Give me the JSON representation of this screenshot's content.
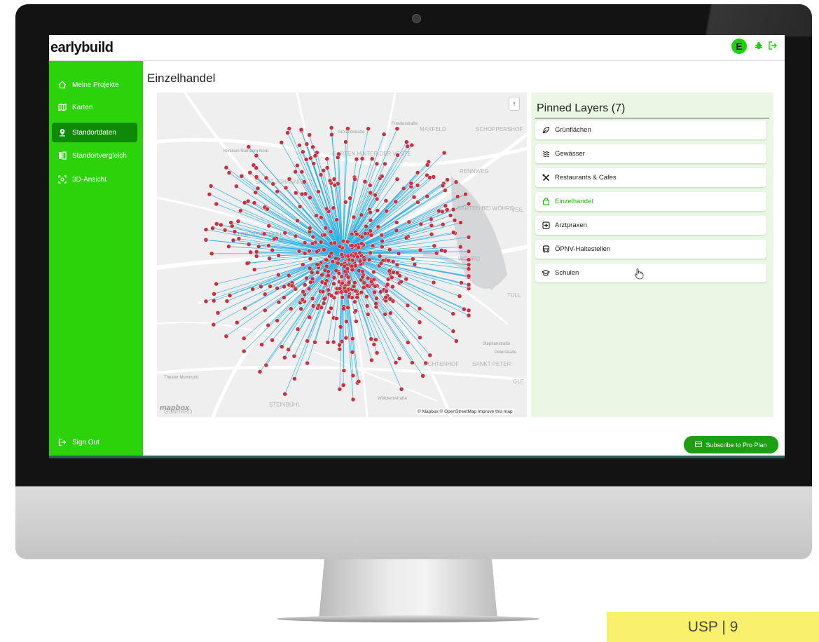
{
  "app": {
    "logo": "earlybuild",
    "user_initial": "E"
  },
  "sidebar": {
    "items": [
      {
        "label": "Meine Projekte",
        "icon": "home-icon"
      },
      {
        "label": "Karten",
        "icon": "map-icon"
      },
      {
        "label": "Standortdaten",
        "icon": "location-pin-icon",
        "active": true
      },
      {
        "label": "Standortvergleich",
        "icon": "compare-icon"
      },
      {
        "label": "3D-Ansicht",
        "icon": "3d-view-icon"
      }
    ],
    "sign_out": "Sign Out",
    "collapse": "‹"
  },
  "main": {
    "title": "Einzelhandel"
  },
  "map": {
    "attribution": "© Mapbox © OpenStreetMap Improve this map",
    "brand": "mapbox",
    "compass": "↑",
    "labels": [
      "Friedenstraße",
      "Grolandstraße",
      "MAXFELD",
      "SCHOPPERSHOF",
      "Klinikum Nürnberg Nord",
      "GARTEN HINTER DER VESTE",
      "RENNWEG",
      "SANKT JOHANNIS",
      "GARTEN BEI WÖHRD",
      "VEIL",
      "KLEINWEIDENMÜHLE",
      "WÖHRD",
      "TULL",
      "Stephanstraße",
      "Peterstraße",
      "SANKT PETER",
      "LICHTENHOF",
      "GLE",
      "Theater Mummpitz",
      "STEINBÜHL",
      "GUNHARD",
      "Wölckernstraße"
    ],
    "line_color": "#29aee6",
    "point_color": "#c8303f"
  },
  "panel": {
    "title": "Pinned Layers (7)",
    "layers": [
      {
        "label": "Grünflächen",
        "icon": "leaf-icon"
      },
      {
        "label": "Gewässer",
        "icon": "water-icon"
      },
      {
        "label": "Restaurants & Cafes",
        "icon": "cutlery-icon"
      },
      {
        "label": "Einzelhandel",
        "icon": "shopping-bag-icon",
        "active": true
      },
      {
        "label": "Arztpraxen",
        "icon": "medical-icon"
      },
      {
        "label": "ÖPNV-Haltestellen",
        "icon": "bus-icon"
      },
      {
        "label": "Schulen",
        "icon": "school-icon"
      }
    ]
  },
  "subscribe": "Subscribe to Pro Plan",
  "badge": "USP | 9",
  "colors": {
    "accent": "#2bd40a",
    "active_nav": "#0e8a07",
    "button": "#1d9f14",
    "badge": "#f9f06b"
  }
}
